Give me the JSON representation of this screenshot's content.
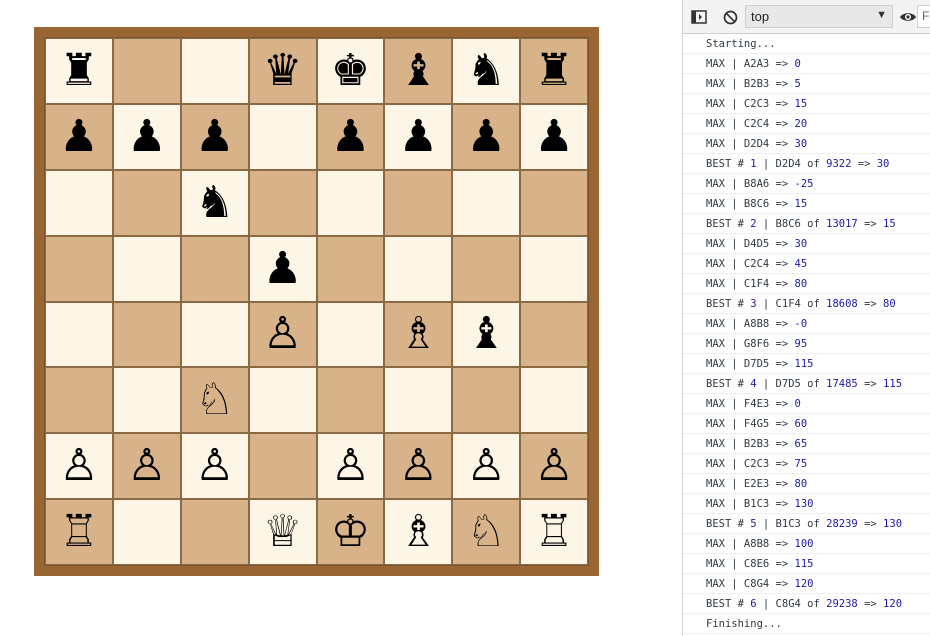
{
  "board": {
    "squares": [
      [
        "♜",
        "",
        "",
        "♛",
        "♚",
        "♝",
        "♞",
        "♜"
      ],
      [
        "♟",
        "♟",
        "♟",
        "",
        "♟",
        "♟",
        "♟",
        "♟"
      ],
      [
        "",
        "",
        "♞",
        "",
        "",
        "",
        "",
        ""
      ],
      [
        "",
        "",
        "",
        "♟",
        "",
        "",
        "",
        ""
      ],
      [
        "",
        "",
        "",
        "♙",
        "",
        "♗",
        "♝",
        ""
      ],
      [
        "",
        "",
        "♘",
        "",
        "",
        "",
        "",
        ""
      ],
      [
        "♙",
        "♙",
        "♙",
        "",
        "♙",
        "♙",
        "♙",
        "♙"
      ],
      [
        "♖",
        "",
        "",
        "♕",
        "♔",
        "♗",
        "♘",
        "♖"
      ]
    ],
    "piece_icon_names": {
      "♜": "black-rook-icon",
      "♞": "black-knight-icon",
      "♝": "black-bishop-icon",
      "♛": "black-queen-icon",
      "♚": "black-king-icon",
      "♟": "black-pawn-icon",
      "♖": "white-rook-icon",
      "♘": "white-knight-icon",
      "♗": "white-bishop-icon",
      "♕": "white-queen-icon",
      "♔": "white-king-icon",
      "♙": "white-pawn-icon"
    },
    "colors": {
      "frame": "#996633",
      "light": "#fdf5e6",
      "dark": "#d8b38a"
    }
  },
  "devtools": {
    "toolbar": {
      "sidebar_icon": "show-sidebar-icon",
      "clear_icon": "clear-console-icon",
      "context_value": "top",
      "eye_icon": "live-expression-eye-icon",
      "filter_placeholder": "Filter"
    },
    "log": [
      [
        {
          "t": "Starting..."
        }
      ],
      [
        {
          "t": "MAX | A2A3 => "
        },
        {
          "t": "0",
          "n": true
        }
      ],
      [
        {
          "t": "MAX | B2B3 => "
        },
        {
          "t": "5",
          "n": true
        }
      ],
      [
        {
          "t": "MAX | C2C3 => "
        },
        {
          "t": "15",
          "n": true
        }
      ],
      [
        {
          "t": "MAX | C2C4 => "
        },
        {
          "t": "20",
          "n": true
        }
      ],
      [
        {
          "t": "MAX | D2D4 => "
        },
        {
          "t": "30",
          "n": true
        }
      ],
      [
        {
          "t": "BEST # "
        },
        {
          "t": "1",
          "n": true
        },
        {
          "t": " | D2D4 of "
        },
        {
          "t": "9322",
          "n": true
        },
        {
          "t": " => "
        },
        {
          "t": "30",
          "n": true
        }
      ],
      [
        {
          "t": "MAX | B8A6 => "
        },
        {
          "t": "-25",
          "n": true
        }
      ],
      [
        {
          "t": "MAX | B8C6 => "
        },
        {
          "t": "15",
          "n": true
        }
      ],
      [
        {
          "t": "BEST # "
        },
        {
          "t": "2",
          "n": true
        },
        {
          "t": " | B8C6 of "
        },
        {
          "t": "13017",
          "n": true
        },
        {
          "t": " => "
        },
        {
          "t": "15",
          "n": true
        }
      ],
      [
        {
          "t": "MAX | D4D5 => "
        },
        {
          "t": "30",
          "n": true
        }
      ],
      [
        {
          "t": "MAX | C2C4 => "
        },
        {
          "t": "45",
          "n": true
        }
      ],
      [
        {
          "t": "MAX | C1F4 => "
        },
        {
          "t": "80",
          "n": true
        }
      ],
      [
        {
          "t": "BEST # "
        },
        {
          "t": "3",
          "n": true
        },
        {
          "t": " | C1F4 of "
        },
        {
          "t": "18608",
          "n": true
        },
        {
          "t": " => "
        },
        {
          "t": "80",
          "n": true
        }
      ],
      [
        {
          "t": "MAX | A8B8 => "
        },
        {
          "t": "-0",
          "n": true
        }
      ],
      [
        {
          "t": "MAX | G8F6 => "
        },
        {
          "t": "95",
          "n": true
        }
      ],
      [
        {
          "t": "MAX | D7D5 => "
        },
        {
          "t": "115",
          "n": true
        }
      ],
      [
        {
          "t": "BEST # "
        },
        {
          "t": "4",
          "n": true
        },
        {
          "t": " | D7D5 of "
        },
        {
          "t": "17485",
          "n": true
        },
        {
          "t": " => "
        },
        {
          "t": "115",
          "n": true
        }
      ],
      [
        {
          "t": "MAX | F4E3 => "
        },
        {
          "t": "0",
          "n": true
        }
      ],
      [
        {
          "t": "MAX | F4G5 => "
        },
        {
          "t": "60",
          "n": true
        }
      ],
      [
        {
          "t": "MAX | B2B3 => "
        },
        {
          "t": "65",
          "n": true
        }
      ],
      [
        {
          "t": "MAX | C2C3 => "
        },
        {
          "t": "75",
          "n": true
        }
      ],
      [
        {
          "t": "MAX | E2E3 => "
        },
        {
          "t": "80",
          "n": true
        }
      ],
      [
        {
          "t": "MAX | B1C3 => "
        },
        {
          "t": "130",
          "n": true
        }
      ],
      [
        {
          "t": "BEST # "
        },
        {
          "t": "5",
          "n": true
        },
        {
          "t": " | B1C3 of "
        },
        {
          "t": "28239",
          "n": true
        },
        {
          "t": " => "
        },
        {
          "t": "130",
          "n": true
        }
      ],
      [
        {
          "t": "MAX | A8B8 => "
        },
        {
          "t": "100",
          "n": true
        }
      ],
      [
        {
          "t": "MAX | C8E6 => "
        },
        {
          "t": "115",
          "n": true
        }
      ],
      [
        {
          "t": "MAX | C8G4 => "
        },
        {
          "t": "120",
          "n": true
        }
      ],
      [
        {
          "t": "BEST # "
        },
        {
          "t": "6",
          "n": true
        },
        {
          "t": " | C8G4 of "
        },
        {
          "t": "29238",
          "n": true
        },
        {
          "t": " => "
        },
        {
          "t": "120",
          "n": true
        }
      ],
      [
        {
          "t": "Finishing..."
        }
      ]
    ]
  }
}
